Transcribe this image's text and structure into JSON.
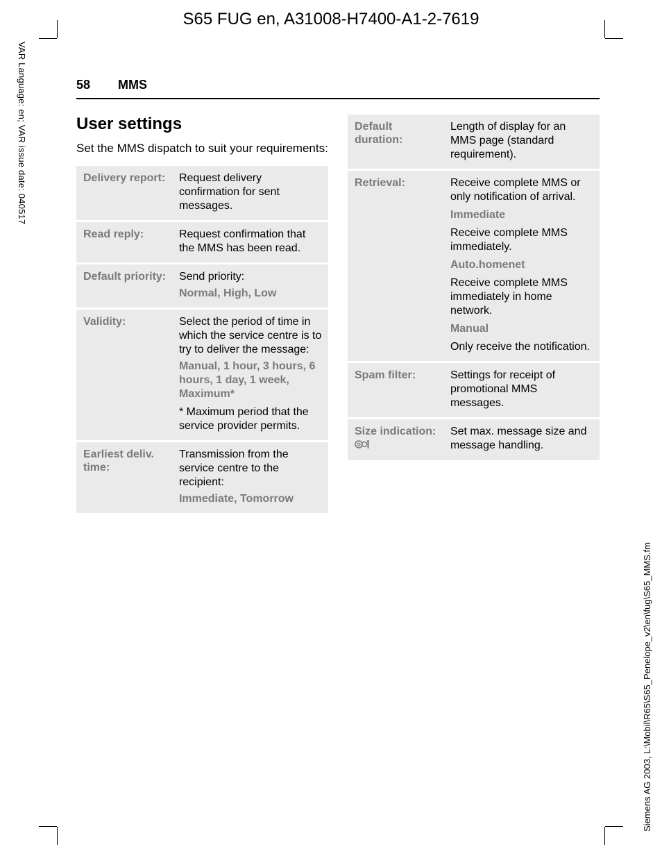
{
  "doc_header": "S65 FUG en, A31008-H7400-A1-2-7619",
  "margin_left_text": "VAR Language: en; VAR issue date: 040517",
  "margin_right_text": "Siemens AG 2003, L:\\Mobil\\R65\\S65_Penelope_v2\\en\\fug\\S65_MMS.fm",
  "header": {
    "page_number": "58",
    "section": "MMS"
  },
  "title": "User settings",
  "intro": "Set the MMS dispatch to suit your requirements:",
  "left_table": [
    {
      "label": "Delivery report:",
      "desc": "Request delivery confirmation for sent messages."
    },
    {
      "label": "Read reply:",
      "desc": "Request confirmation that the MMS has been read."
    },
    {
      "label": "Default priority:",
      "desc": "Send priority:",
      "options": [
        "Normal",
        "High",
        "Low"
      ]
    },
    {
      "label": "Validity:",
      "desc": "Select the period of time in which the service centre is to try to deliver the message:",
      "options": [
        "Manual",
        "1 hour",
        "3 hours",
        "6 hours",
        "1 day",
        "1 week",
        "Maximum*"
      ],
      "note": "* Maximum period that the service provider permits."
    },
    {
      "label": "Earliest deliv. time:",
      "desc": "Transmission from the service centre to the recipient:",
      "options": [
        "Immediate",
        "Tomorrow"
      ]
    }
  ],
  "right_table": [
    {
      "label": "Default duration:",
      "desc": "Length of display for an MMS page (standard requirement)."
    },
    {
      "label": "Retrieval:",
      "desc": "Receive complete MMS or only notification of arrival.",
      "subitems": [
        {
          "head": "Immediate",
          "body": "Receive complete MMS immediately."
        },
        {
          "head": "Auto.homenet",
          "body": "Receive complete MMS immediately in home network."
        },
        {
          "head": "Manual",
          "body": "Only receive the notification."
        }
      ]
    },
    {
      "label": "Spam filter:",
      "desc": "Settings for receipt of promotional MMS messages."
    },
    {
      "label": "Size indication:",
      "has_icon": true,
      "desc": "Set max. message size and message handling."
    }
  ]
}
